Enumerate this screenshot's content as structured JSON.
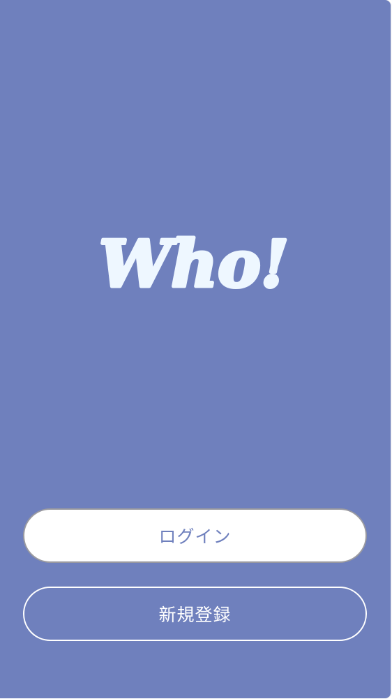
{
  "logo": {
    "text": "Who!"
  },
  "buttons": {
    "login_label": "ログイン",
    "signup_label": "新規登録"
  },
  "colors": {
    "background": "#6f80bd",
    "logo": "#eef7ff",
    "login_bg": "#ffffff",
    "login_text": "#6f80bd",
    "signup_border": "#ffffff"
  }
}
